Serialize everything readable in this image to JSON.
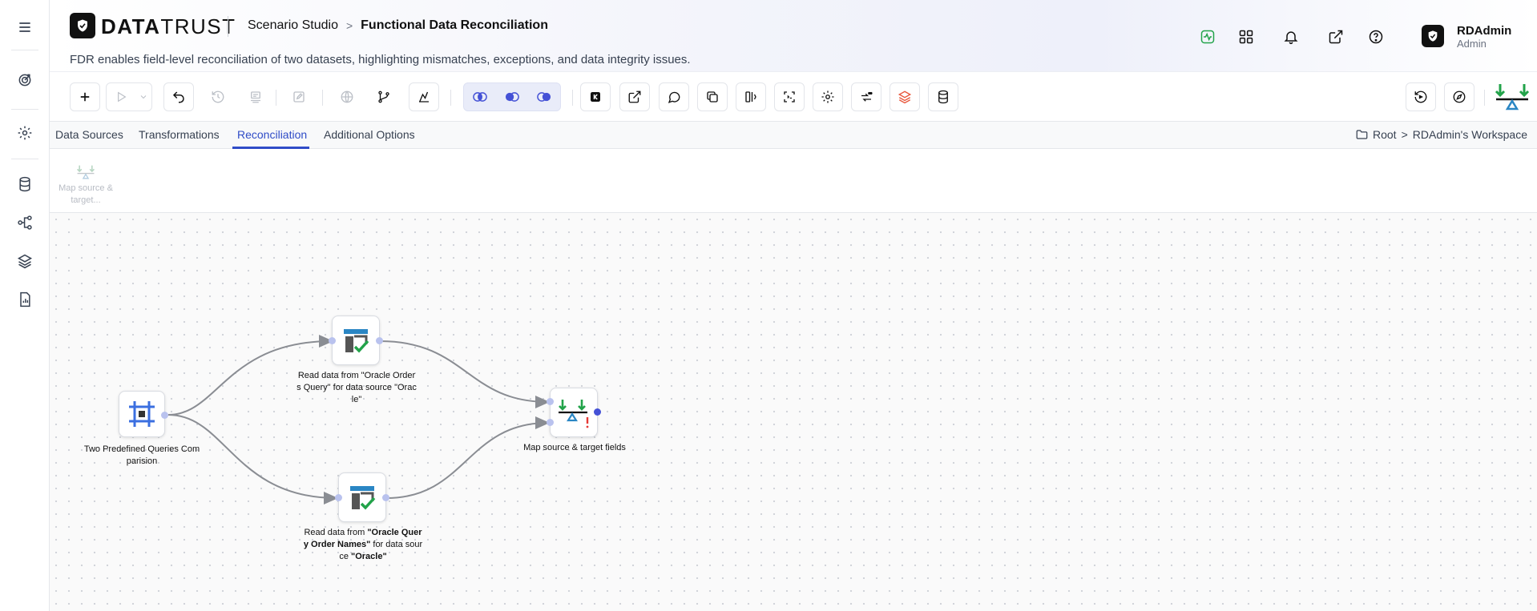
{
  "brand": {
    "name_bold": "DATA",
    "name_light": "TRUST"
  },
  "header": {
    "breadcrumb_root": "Scenario Studio",
    "breadcrumb_separator": ">",
    "breadcrumb_current": "Functional Data Reconciliation",
    "description": "FDR enables field-level reconciliation of two datasets, highlighting mismatches, exceptions, and data integrity issues."
  },
  "user": {
    "name": "RDAdmin",
    "role": "Admin"
  },
  "tabs": [
    {
      "label": "Data Sources",
      "active": false
    },
    {
      "label": "Transformations",
      "active": false
    },
    {
      "label": "Reconciliation",
      "active": true
    },
    {
      "label": "Additional Options",
      "active": false
    }
  ],
  "workspace": {
    "root": "Root",
    "separator": ">",
    "name": "RDAdmin's Workspace"
  },
  "palette": {
    "item_label": "Map source & target..."
  },
  "nodes": {
    "source": {
      "label": "Two Predefined Queries Comparision"
    },
    "read_top": {
      "label": "Read data from \"Oracle Orders Query\" for data source \"Oracle\""
    },
    "read_bottom": {
      "label_part1": "Read data from ",
      "label_bold1": "\"Oracle Query Order Names\"",
      "label_part2": " for data source ",
      "label_bold2": "\"Oracle\""
    },
    "map": {
      "label": "Map source & target fields"
    }
  },
  "colors": {
    "accent": "#2f4cc7",
    "success": "#22a34a",
    "warning": "#e53935",
    "port": "#4451d6"
  },
  "icons": [
    "menu-icon",
    "target-icon",
    "gear-icon",
    "database-icon",
    "workflow-icon",
    "layers-icon",
    "report-icon",
    "activity-icon",
    "grid-icon",
    "bell-icon",
    "external-link-icon",
    "help-icon"
  ]
}
